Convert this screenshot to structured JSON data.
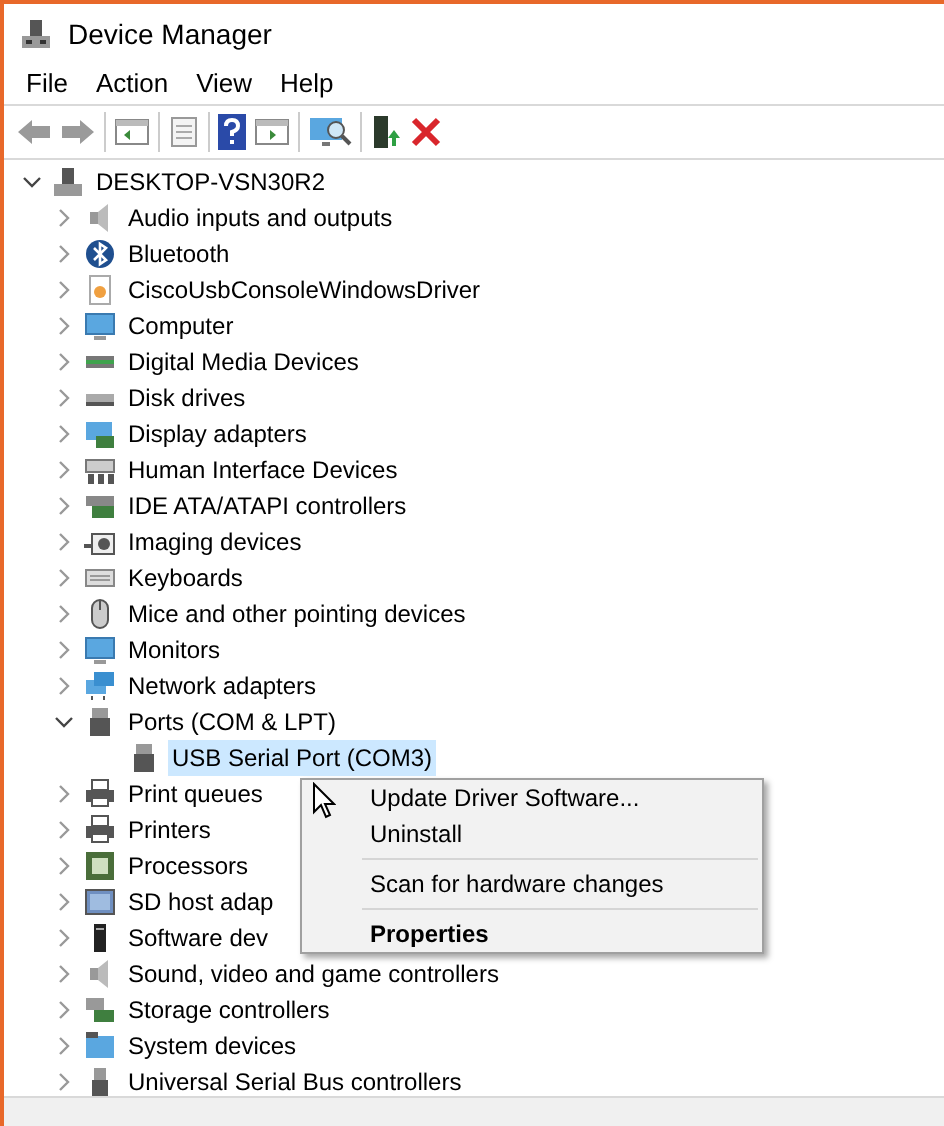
{
  "window": {
    "title": "Device Manager"
  },
  "menu_bar": [
    "File",
    "Action",
    "View",
    "Help"
  ],
  "tree": {
    "label": "DESKTOP-VSN30R2",
    "expanded": true,
    "selected": false,
    "children": [
      {
        "label": "Audio inputs and outputs",
        "expanded": false,
        "selected": false
      },
      {
        "label": "Bluetooth",
        "expanded": false,
        "selected": false
      },
      {
        "label": "CiscoUsbConsoleWindowsDriver",
        "expanded": false,
        "selected": false
      },
      {
        "label": "Computer",
        "expanded": false,
        "selected": false
      },
      {
        "label": "Digital Media Devices",
        "expanded": false,
        "selected": false
      },
      {
        "label": "Disk drives",
        "expanded": false,
        "selected": false
      },
      {
        "label": "Display adapters",
        "expanded": false,
        "selected": false
      },
      {
        "label": "Human Interface Devices",
        "expanded": false,
        "selected": false
      },
      {
        "label": "IDE ATA/ATAPI controllers",
        "expanded": false,
        "selected": false
      },
      {
        "label": "Imaging devices",
        "expanded": false,
        "selected": false
      },
      {
        "label": "Keyboards",
        "expanded": false,
        "selected": false
      },
      {
        "label": "Mice and other pointing devices",
        "expanded": false,
        "selected": false
      },
      {
        "label": "Monitors",
        "expanded": false,
        "selected": false
      },
      {
        "label": "Network adapters",
        "expanded": false,
        "selected": false
      },
      {
        "label": "Ports (COM & LPT)",
        "expanded": true,
        "selected": false,
        "children": [
          {
            "label": "USB Serial Port (COM3)",
            "selected": true
          }
        ]
      },
      {
        "label": "Print queues",
        "expanded": false,
        "selected": false
      },
      {
        "label": "Printers",
        "expanded": false,
        "selected": false
      },
      {
        "label": "Processors",
        "expanded": false,
        "selected": false
      },
      {
        "label": "SD host adap",
        "expanded": false,
        "selected": false
      },
      {
        "label": "Software dev",
        "expanded": false,
        "selected": false
      },
      {
        "label": "Sound, video and game controllers",
        "expanded": false,
        "selected": false
      },
      {
        "label": "Storage controllers",
        "expanded": false,
        "selected": false
      },
      {
        "label": "System devices",
        "expanded": false,
        "selected": false
      },
      {
        "label": "Universal Serial Bus controllers",
        "expanded": false,
        "selected": false
      }
    ]
  },
  "context_menu": {
    "items": [
      {
        "kind": "item",
        "label": "Update Driver Software..."
      },
      {
        "kind": "item",
        "label": "Uninstall"
      },
      {
        "kind": "separator"
      },
      {
        "kind": "item",
        "label": "Scan for hardware changes"
      },
      {
        "kind": "separator"
      },
      {
        "kind": "default",
        "label": "Properties"
      }
    ]
  }
}
